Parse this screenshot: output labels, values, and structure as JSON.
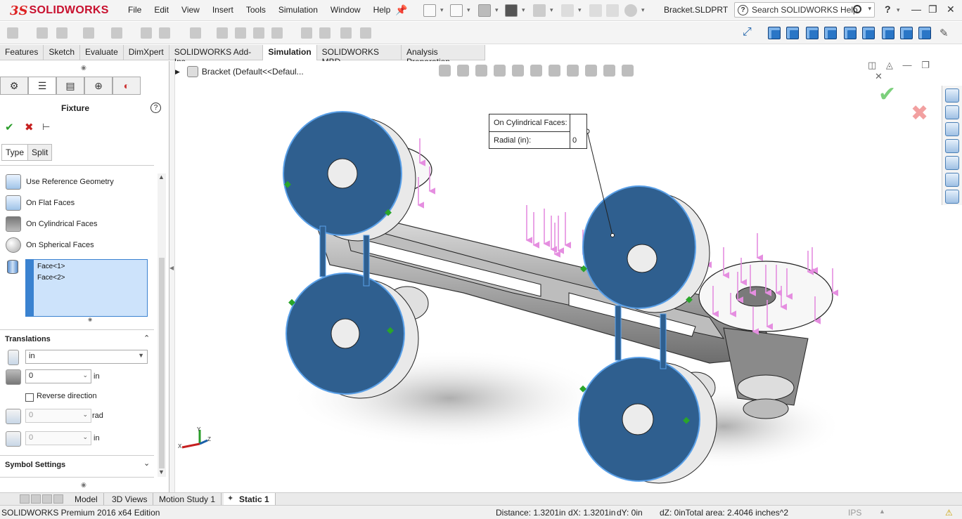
{
  "app": {
    "logo_ds": "3S",
    "logo_text": "SOLIDWORKS",
    "document": "Bracket.SLDPRT",
    "search_placeholder": "Search SOLIDWORKS Help",
    "help_glyph": "?"
  },
  "menu": [
    "File",
    "Edit",
    "View",
    "Insert",
    "Tools",
    "Simulation",
    "Window",
    "Help"
  ],
  "tabs": [
    {
      "label": "Features",
      "active": false
    },
    {
      "label": "Sketch",
      "active": false
    },
    {
      "label": "Evaluate",
      "active": false
    },
    {
      "label": "DimXpert",
      "active": false
    },
    {
      "label": "SOLIDWORKS Add-Ins",
      "active": false
    },
    {
      "label": "Simulation",
      "active": true
    },
    {
      "label": "SOLIDWORKS MBD",
      "active": false
    },
    {
      "label": "Analysis Preparation",
      "active": false
    }
  ],
  "property_manager": {
    "title": "Fixture",
    "help": "?",
    "subtabs": [
      "Type",
      "Split"
    ],
    "options": [
      {
        "label": "Use Reference Geometry",
        "icon": "reference-geometry-icon"
      },
      {
        "label": "On Flat Faces",
        "icon": "flat-faces-icon"
      },
      {
        "label": "On Cylindrical Faces",
        "icon": "cylindrical-faces-icon",
        "selected": true
      },
      {
        "label": "On Spherical Faces",
        "icon": "spherical-faces-icon"
      }
    ],
    "faces": [
      "Face<1>",
      "Face<2>"
    ],
    "translations": {
      "header": "Translations",
      "unit_select": "in",
      "radial_value": "0",
      "radial_unit": "in",
      "reverse_direction_label": "Reverse direction",
      "reverse_direction_checked": false,
      "circumferential_value": "0",
      "circumferential_unit": "rad",
      "axial_value": "0",
      "axial_unit": "in"
    },
    "symbol_settings": "Symbol Settings"
  },
  "graphics": {
    "tree_label": "Bracket  (Default<<Defaul...",
    "callout": {
      "row1_label": "On Cylindrical Faces:",
      "row2_label": "Radial (in):",
      "row2_value": "0"
    }
  },
  "bottom_tabs": [
    {
      "label": "Model",
      "active": false
    },
    {
      "label": "3D Views",
      "active": false
    },
    {
      "label": "Motion Study 1",
      "active": false
    },
    {
      "label": "Static 1",
      "active": true
    }
  ],
  "status": {
    "edition": "SOLIDWORKS Premium 2016 x64 Edition",
    "distance": "Distance: 1.3201in",
    "dx": "dX: 1.3201in",
    "dy": "dY: 0in",
    "dz_total": "dZ: 0inTotal area: 2.4046 inches^2",
    "units": "IPS"
  },
  "colors": {
    "accent": "#2a76c6",
    "part_face": "#2f5f8f",
    "load_arrow": "#e58ee0",
    "fixture_green": "#2aa52a"
  }
}
